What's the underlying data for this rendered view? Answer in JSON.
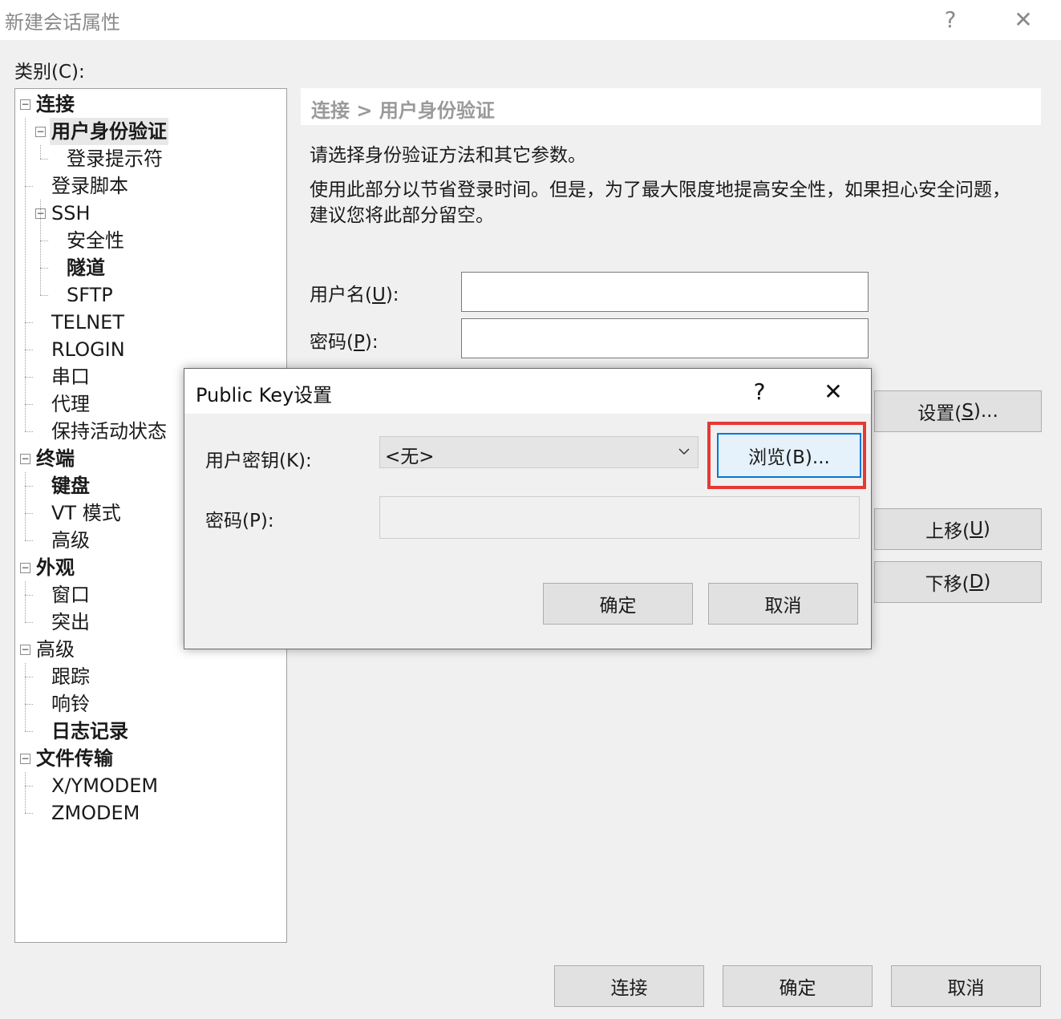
{
  "window": {
    "title": "新建会话属性",
    "help_glyph": "?",
    "close_glyph": "✕"
  },
  "category_label": "类别(C):",
  "tree": [
    {
      "label": "连接",
      "bold": true,
      "expander": "−"
    },
    {
      "label": "用户身份验证",
      "bold": true,
      "expander": "−",
      "selected": true
    },
    {
      "label": "登录提示符"
    },
    {
      "label": "登录脚本"
    },
    {
      "label": "SSH",
      "expander": "−"
    },
    {
      "label": "安全性"
    },
    {
      "label": "隧道",
      "bold": true
    },
    {
      "label": "SFTP"
    },
    {
      "label": "TELNET"
    },
    {
      "label": "RLOGIN"
    },
    {
      "label": "串口"
    },
    {
      "label": "代理"
    },
    {
      "label": "保持活动状态"
    },
    {
      "label": "终端",
      "bold": true,
      "expander": "−"
    },
    {
      "label": "键盘",
      "bold": true
    },
    {
      "label": "VT 模式"
    },
    {
      "label": "高级"
    },
    {
      "label": "外观",
      "bold": true,
      "expander": "−"
    },
    {
      "label": "窗口"
    },
    {
      "label": "突出"
    },
    {
      "label": "高级",
      "expander": "−"
    },
    {
      "label": "跟踪"
    },
    {
      "label": "响铃"
    },
    {
      "label": "日志记录",
      "bold": true
    },
    {
      "label": "文件传输",
      "bold": true,
      "expander": "−"
    },
    {
      "label": "X/YMODEM"
    },
    {
      "label": "ZMODEM"
    }
  ],
  "main": {
    "breadcrumb": "连接 > 用户身份验证",
    "desc1": "请选择身份验证方法和其它参数。",
    "desc2": "使用此部分以节省登录时间。但是，为了最大限度地提高安全性，如果担心安全问题，",
    "desc3": "建议您将此部分留空。",
    "username_label": "用户名(",
    "username_key": "U",
    "username_label_end": "):",
    "password_label": "密码(",
    "password_key": "P",
    "password_label_end": "):",
    "username_value": "",
    "password_value": "",
    "settings_button": "设置(",
    "settings_key": "S",
    "settings_end": ")...",
    "moveup_button": "上移(",
    "moveup_key": "U",
    "moveup_end": ")",
    "movedown_button": "下移(",
    "movedown_key": "D",
    "movedown_end": ")"
  },
  "dialog": {
    "title": "Public Key设置",
    "help_glyph": "?",
    "close_glyph": "✕",
    "user_key_label": "用户密钥(K):",
    "user_key_value": "<无>",
    "browse_button": "浏览(B)...",
    "passphrase_label": "密码(P):",
    "passphrase_value": "",
    "ok_button": "确定",
    "cancel_button": "取消",
    "highlight_color": "#e53935"
  },
  "footer": {
    "connect_button": "连接",
    "ok_button": "确定",
    "cancel_button": "取消"
  }
}
